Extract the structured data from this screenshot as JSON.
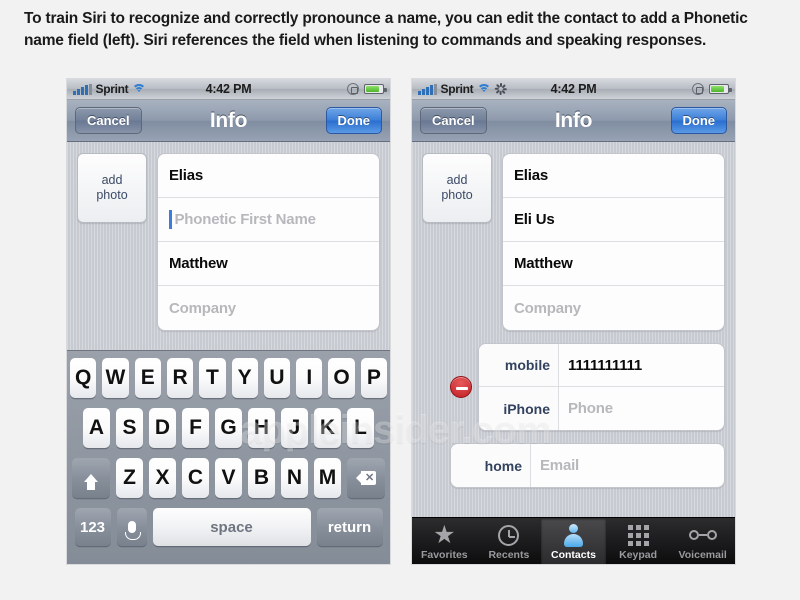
{
  "caption": "To train Siri to recognize and correctly pronounce a name, you can edit the contact to add a Phonetic name field (left). Siri references the field when listening to commands and speaking responses.",
  "watermark": "appleinsider.com",
  "colors": {
    "page_background": "#f2f2f2",
    "navbar_blue_button": "#3d7fd8",
    "delete_red": "#bf1f25",
    "placeholder_gray": "#b6b8bc",
    "caret_blue": "#3b7ddd",
    "keyboard_background": "#8a929c",
    "tabbar_black": "#0b0b0c",
    "contacts_icon_blue": "#4aa8e8"
  },
  "phone_left": {
    "status_bar": {
      "carrier": "Sprint",
      "time": "4:42 PM",
      "signal_icon": "signal-bars-icon",
      "wifi_icon": "wifi-icon",
      "rotation_lock_icon": "rotation-lock-icon",
      "battery_icon": "battery-icon",
      "activity_spinner": false
    },
    "nav": {
      "cancel_label": "Cancel",
      "title": "Info",
      "done_label": "Done"
    },
    "add_photo": {
      "line1": "add",
      "line2": "photo"
    },
    "fields": [
      {
        "value": "Elias",
        "placeholder": "",
        "filled": true,
        "focused": false
      },
      {
        "value": "",
        "placeholder": "Phonetic First Name",
        "filled": false,
        "focused": true
      },
      {
        "value": "Matthew",
        "placeholder": "",
        "filled": true,
        "focused": false
      },
      {
        "value": "",
        "placeholder": "Company",
        "filled": false,
        "focused": false
      }
    ],
    "keyboard": {
      "row1": [
        "Q",
        "W",
        "E",
        "R",
        "T",
        "Y",
        "U",
        "I",
        "O",
        "P"
      ],
      "row2": [
        "A",
        "S",
        "D",
        "F",
        "G",
        "H",
        "J",
        "K",
        "L"
      ],
      "row3": [
        "Z",
        "X",
        "C",
        "V",
        "B",
        "N",
        "M"
      ],
      "shift_icon": "shift-arrow-icon",
      "delete_icon": "backspace-icon",
      "num_label": "123",
      "mic_icon": "microphone-icon",
      "space_label": "space",
      "return_label": "return"
    }
  },
  "phone_right": {
    "status_bar": {
      "carrier": "Sprint",
      "time": "4:42 PM",
      "signal_icon": "signal-bars-icon",
      "wifi_icon": "wifi-icon",
      "rotation_lock_icon": "rotation-lock-icon",
      "battery_icon": "battery-icon",
      "activity_spinner": true
    },
    "nav": {
      "cancel_label": "Cancel",
      "title": "Info",
      "done_label": "Done"
    },
    "add_photo": {
      "line1": "add",
      "line2": "photo"
    },
    "fields": [
      {
        "value": "Elias",
        "placeholder": "",
        "filled": true,
        "focused": false
      },
      {
        "value": "Eli Us",
        "placeholder": "",
        "filled": true,
        "focused": false
      },
      {
        "value": "Matthew",
        "placeholder": "",
        "filled": true,
        "focused": false
      },
      {
        "value": "",
        "placeholder": "Company",
        "filled": false,
        "focused": false
      }
    ],
    "phone_group": {
      "delete_icon": "remove-minus-icon",
      "rows": [
        {
          "label": "mobile",
          "value": "1111111111",
          "placeholder": "",
          "filled": true
        },
        {
          "label": "iPhone",
          "value": "",
          "placeholder": "Phone",
          "filled": false
        }
      ]
    },
    "email_group": {
      "rows": [
        {
          "label": "home",
          "value": "",
          "placeholder": "Email",
          "filled": false
        }
      ]
    },
    "tabbar": [
      {
        "label": "Favorites",
        "icon": "star-icon",
        "selected": false
      },
      {
        "label": "Recents",
        "icon": "clock-icon",
        "selected": false
      },
      {
        "label": "Contacts",
        "icon": "person-icon",
        "selected": true
      },
      {
        "label": "Keypad",
        "icon": "keypad-icon",
        "selected": false
      },
      {
        "label": "Voicemail",
        "icon": "voicemail-icon",
        "selected": false
      }
    ]
  }
}
